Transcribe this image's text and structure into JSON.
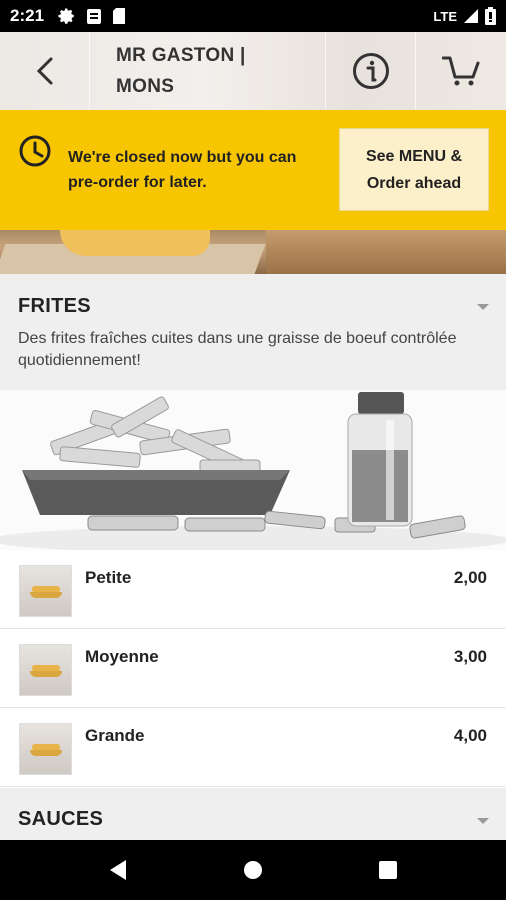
{
  "status_bar": {
    "time": "2:21",
    "network": "LTE",
    "icons": [
      "gear-icon",
      "clipboard-icon",
      "sim-icon",
      "signal-icon",
      "battery-icon"
    ]
  },
  "header": {
    "title": "MR GASTON | MONS",
    "icons": [
      "back-arrow-icon",
      "info-icon",
      "cart-icon"
    ]
  },
  "banner": {
    "message": "We're closed now but you can pre-order for later.",
    "button_label": "See MENU & Order ahead",
    "color": "#f7c600"
  },
  "sections": [
    {
      "title": "FRITES",
      "description": "Des frites fraîches cuites dans une graisse de boeuf contrôlée quotidiennement!",
      "items": [
        {
          "name": "Petite",
          "price": "2,00"
        },
        {
          "name": "Moyenne",
          "price": "3,00"
        },
        {
          "name": "Grande",
          "price": "4,00"
        }
      ]
    },
    {
      "title": "SAUCES"
    }
  ],
  "nav": {
    "icons": [
      "back-triangle-icon",
      "home-circle-icon",
      "recents-square-icon"
    ]
  }
}
